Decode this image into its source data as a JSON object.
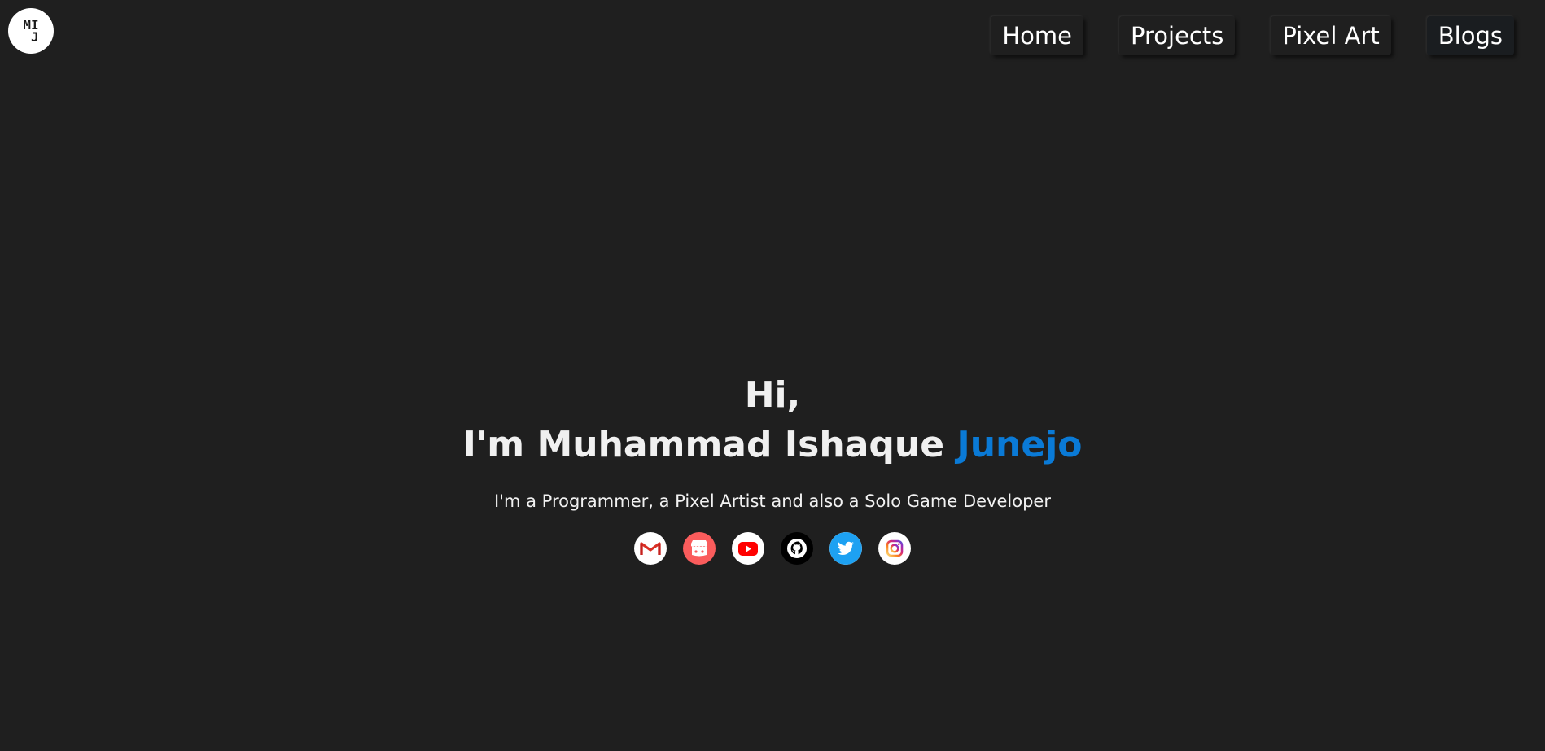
{
  "logo": {
    "text": "MI\n J"
  },
  "nav": {
    "items": [
      {
        "label": "Home"
      },
      {
        "label": "Projects"
      },
      {
        "label": "Pixel Art"
      },
      {
        "label": "Blogs"
      }
    ]
  },
  "hero": {
    "greeting": "Hi,",
    "intro_prefix": "I'm Muhammad Ishaque ",
    "intro_accent": "Junejo",
    "tagline": "I'm a Programmer, a Pixel Artist and also a Solo Game Developer"
  },
  "socials": [
    {
      "icon": "gmail-icon"
    },
    {
      "icon": "itchio-icon"
    },
    {
      "icon": "youtube-icon"
    },
    {
      "icon": "github-icon"
    },
    {
      "icon": "twitter-icon"
    },
    {
      "icon": "instagram-icon"
    }
  ],
  "colors": {
    "background": "#1f1f1f",
    "accent": "#0a7ad6",
    "text": "#f2f2f2"
  }
}
